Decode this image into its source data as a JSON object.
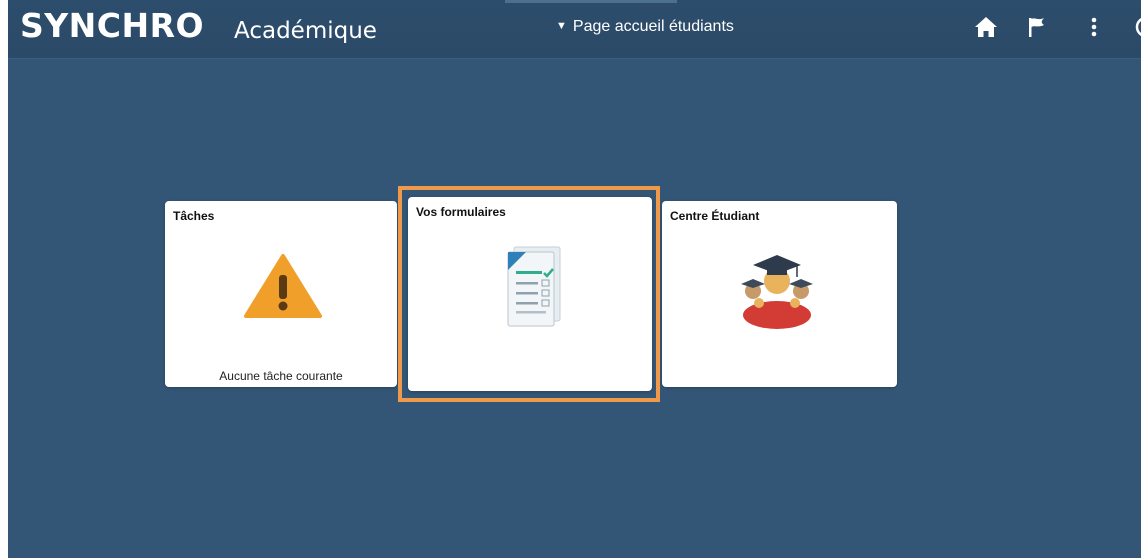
{
  "header": {
    "logo_part1": "SYNC",
    "logo_part2": "HRO",
    "app_name": "Académique",
    "page_selector_label": "Page accueil étudiants",
    "icons": [
      "home-icon",
      "flag-icon",
      "kebab-menu-icon",
      "clock-icon"
    ]
  },
  "tiles": [
    {
      "title": "Tâches",
      "icon": "warning-icon",
      "footer": "Aucune tâche courante"
    },
    {
      "title": "Vos formulaires",
      "icon": "forms-icon",
      "footer": ""
    },
    {
      "title": "Centre Étudiant",
      "icon": "graduate-icon",
      "footer": ""
    }
  ],
  "colors": {
    "background": "#345676",
    "header": "#2d4d6c",
    "highlight": "#ef9a4a",
    "warning": "#f0a02a"
  }
}
